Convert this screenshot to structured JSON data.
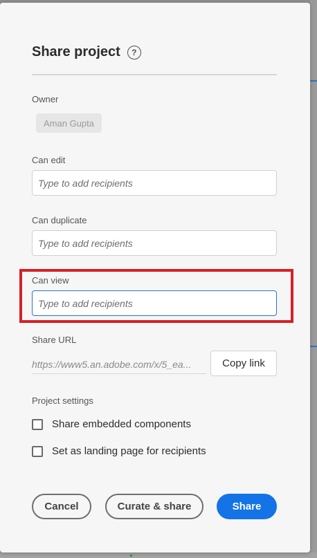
{
  "dialog": {
    "title": "Share project",
    "help_icon": "?",
    "owner": {
      "label": "Owner",
      "name": "Aman Gupta"
    },
    "can_edit": {
      "label": "Can edit",
      "placeholder": "Type to add recipients"
    },
    "can_duplicate": {
      "label": "Can duplicate",
      "placeholder": "Type to add recipients"
    },
    "can_view": {
      "label": "Can view",
      "placeholder": "Type to add recipients"
    },
    "share_url": {
      "label": "Share URL",
      "value": "https://www5.an.adobe.com/x/5_ea...",
      "copy_label": "Copy link"
    },
    "project_settings": {
      "label": "Project settings",
      "options": [
        {
          "label": "Share embedded components",
          "checked": false
        },
        {
          "label": "Set as landing page for recipients",
          "checked": false
        }
      ]
    },
    "footer": {
      "cancel_label": "Cancel",
      "curate_label": "Curate & share",
      "share_label": "Share"
    }
  },
  "colors": {
    "primary": "#1473e6",
    "highlight": "#d62027",
    "focus": "#2b72c9"
  }
}
